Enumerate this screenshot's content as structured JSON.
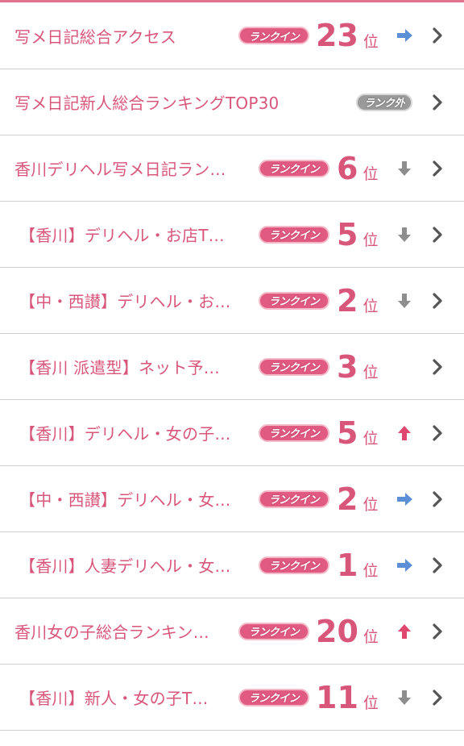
{
  "rows": [
    {
      "title": "写メ日記総合アクセス",
      "indent": false,
      "badge": "ランクイン",
      "badge_type": "in",
      "rank": "23",
      "unit": "位",
      "trend": "right-arrow-icon"
    },
    {
      "title": "写メ日記新人総合ランキングTOP30",
      "indent": false,
      "badge": "ランク外",
      "badge_type": "out",
      "rank": "",
      "unit": "",
      "trend": ""
    },
    {
      "title": "香川デリヘル写メ日記ラン…",
      "indent": false,
      "badge": "ランクイン",
      "badge_type": "in",
      "rank": "6",
      "unit": "位",
      "trend": "down-arrow-icon"
    },
    {
      "title": "【香川】デリヘル・お店T…",
      "indent": true,
      "badge": "ランクイン",
      "badge_type": "in",
      "rank": "5",
      "unit": "位",
      "trend": "down-arrow-icon"
    },
    {
      "title": "【中・西讃】デリヘル・お…",
      "indent": true,
      "badge": "ランクイン",
      "badge_type": "in",
      "rank": "2",
      "unit": "位",
      "trend": "down-arrow-icon"
    },
    {
      "title": "【香川 派遣型】ネット予…",
      "indent": true,
      "badge": "ランクイン",
      "badge_type": "in",
      "rank": "3",
      "unit": "位",
      "trend": ""
    },
    {
      "title": "【香川】デリヘル・女の子…",
      "indent": true,
      "badge": "ランクイン",
      "badge_type": "in",
      "rank": "5",
      "unit": "位",
      "trend": "up-arrow-icon"
    },
    {
      "title": "【中・西讃】デリヘル・女…",
      "indent": true,
      "badge": "ランクイン",
      "badge_type": "in",
      "rank": "2",
      "unit": "位",
      "trend": "right-arrow-icon"
    },
    {
      "title": "【香川】人妻デリヘル・女…",
      "indent": true,
      "badge": "ランクイン",
      "badge_type": "in",
      "rank": "1",
      "unit": "位",
      "trend": "right-arrow-icon"
    },
    {
      "title": "香川女の子総合ランキン…",
      "indent": false,
      "badge": "ランクイン",
      "badge_type": "in",
      "rank": "20",
      "unit": "位",
      "trend": "up-arrow-icon"
    },
    {
      "title": "【香川】新人・女の子T…",
      "indent": true,
      "badge": "ランクイン",
      "badge_type": "in",
      "rank": "11",
      "unit": "位",
      "trend": "down-arrow-icon"
    }
  ],
  "colors": {
    "accent": "#d9567b",
    "badge_in": "#e05a82",
    "badge_out": "#9a9a9a",
    "trend_up": "#e0476f",
    "trend_down": "#8e8e8e",
    "trend_right": "#5b8fd6",
    "chevron": "#555555"
  }
}
